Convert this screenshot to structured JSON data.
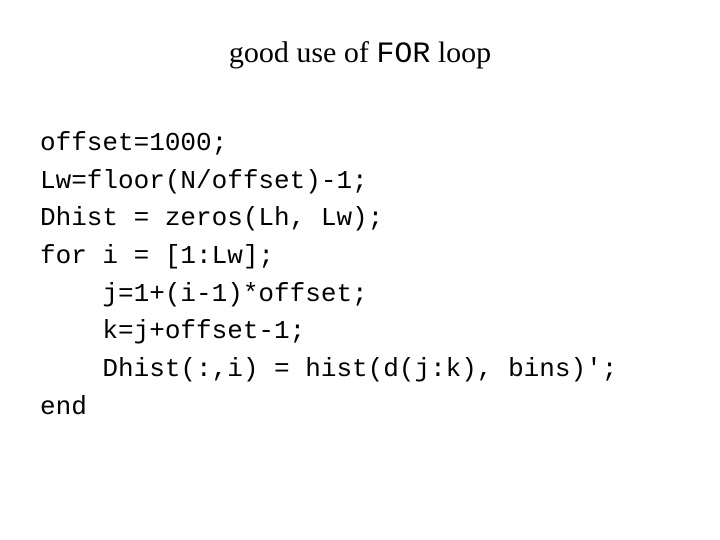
{
  "title": {
    "part1": "good use of ",
    "mono": "FOR",
    "part2": " loop"
  },
  "code": {
    "l1": "offset=1000;",
    "l2": "Lw=floor(N/offset)-1;",
    "l3": "Dhist = zeros(Lh, Lw);",
    "l4": "for i = [1:Lw];",
    "l5": "    j=1+(i-1)*offset;",
    "l6": "    k=j+offset-1;",
    "l7": "    Dhist(:,i) = hist(d(j:k), bins)';",
    "l8": "end"
  }
}
